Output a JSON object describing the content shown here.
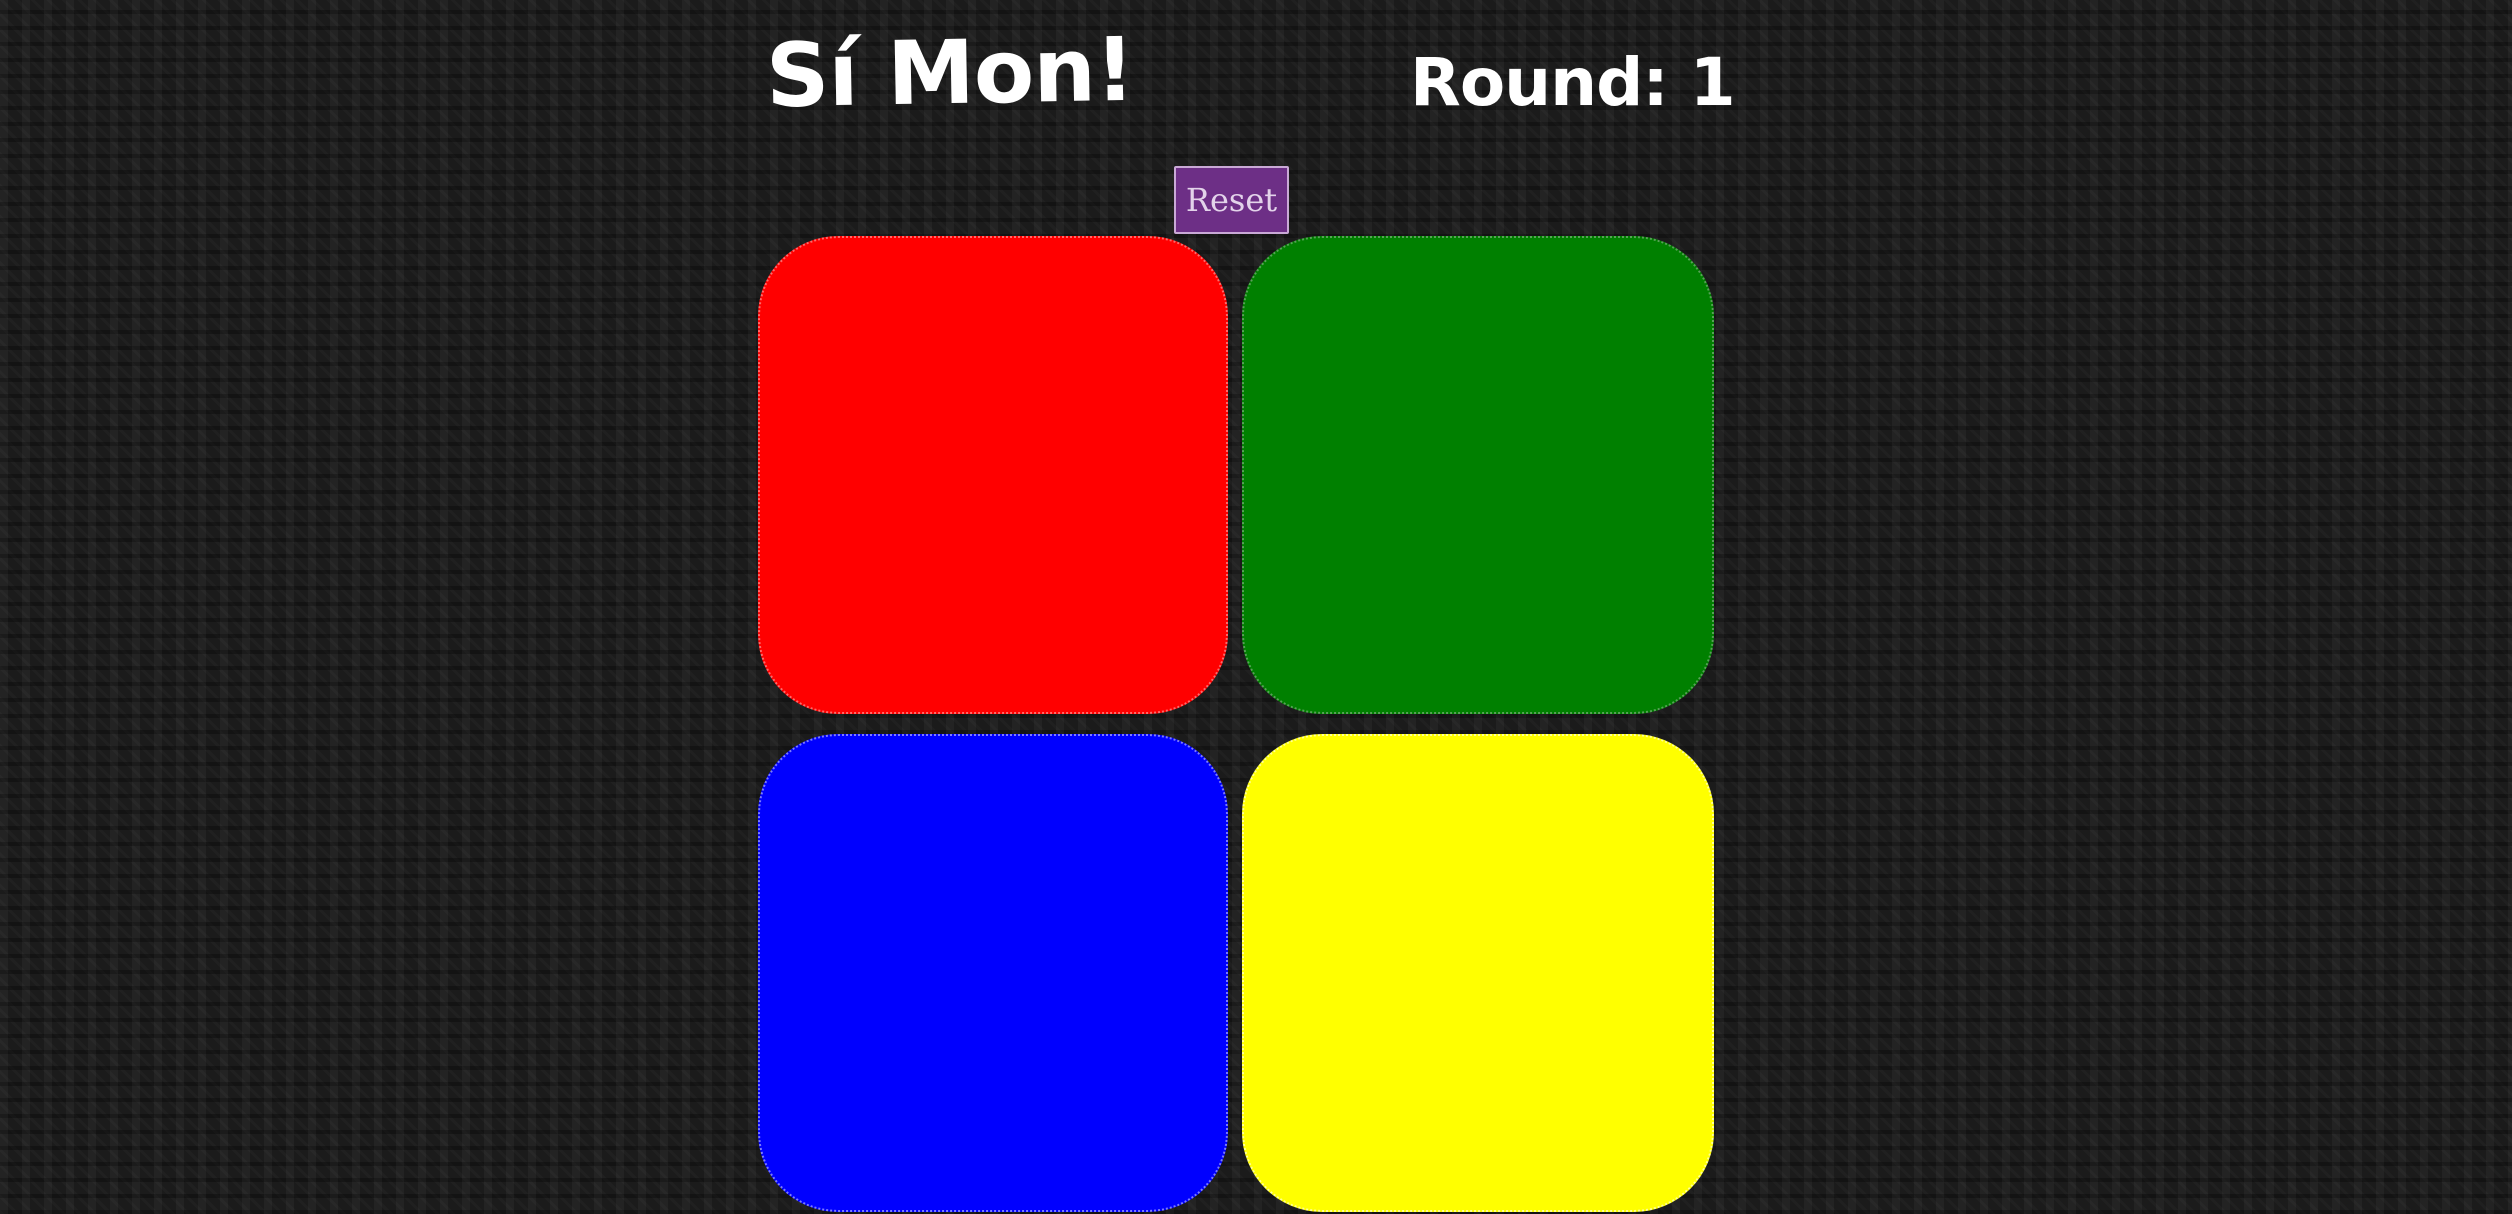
{
  "header": {
    "title": "Sí Mon!",
    "round_text": "Round: 1"
  },
  "controls": {
    "reset_label": "Reset",
    "reset_color": "#6d2f86"
  },
  "board": {
    "pads": [
      {
        "name": "red",
        "color": "#ff0000"
      },
      {
        "name": "green",
        "color": "#008000"
      },
      {
        "name": "blue",
        "color": "#0000ff"
      },
      {
        "name": "yellow",
        "color": "#ffff00"
      }
    ]
  },
  "theme": {
    "background": "#1b1b1b",
    "text_color": "#ffffff"
  }
}
